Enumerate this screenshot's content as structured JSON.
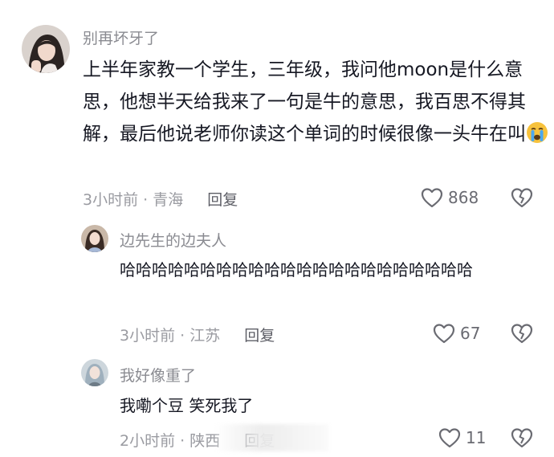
{
  "comments": [
    {
      "username": "别再坏牙了",
      "text": "上半年家教一个学生，三年级，我问他moon是什么意思，他想半天给我来了一句是牛的意思，我百思不得其解，最后他说老师你读这个单词的时候很像一头牛在叫",
      "emoji": "crying-face",
      "time_location": "3小时前 · 青海",
      "reply_label": "回复",
      "likes": "868"
    },
    {
      "username": "边先生的边夫人",
      "text": "哈哈哈哈哈哈哈哈哈哈哈哈哈哈哈哈哈哈哈哈哈哈",
      "time_location": "3小时前 · 江苏",
      "reply_label": "回复",
      "likes": "67"
    },
    {
      "username": "我好像重了",
      "text": "我嘞个豆 笑死我了",
      "time_location": "2小时前 · 陕西",
      "reply_label": "回复",
      "likes": "11"
    }
  ],
  "colors": {
    "text": "#161823",
    "meta": "#9a9ba1",
    "username": "#8a8b91",
    "icon": "#6a6b72"
  },
  "icons": [
    "heart-outline-icon",
    "broken-heart-icon",
    "crying-face-emoji"
  ]
}
